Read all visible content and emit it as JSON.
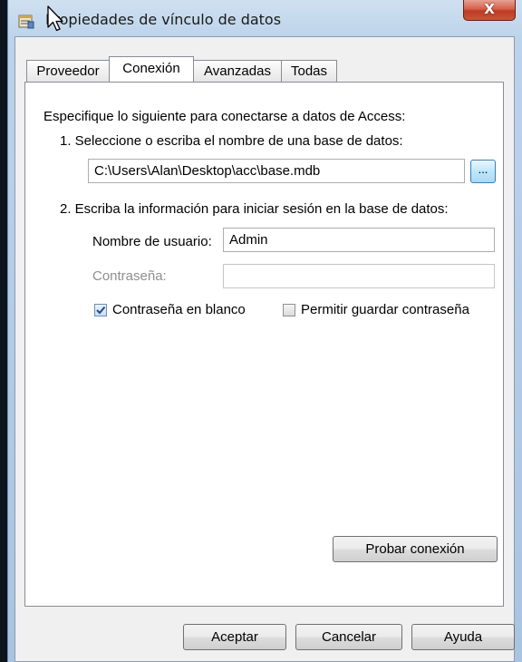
{
  "window": {
    "title": "Propiedades de vínculo de datos",
    "close_label": "X"
  },
  "tabs": [
    {
      "label": "Proveedor",
      "active": false
    },
    {
      "label": "Conexión",
      "active": true
    },
    {
      "label": "Avanzadas",
      "active": false
    },
    {
      "label": "Todas",
      "active": false
    }
  ],
  "connection": {
    "intro": "Especifique lo siguiente para conectarse a datos de Access:",
    "step1_label": "1. Seleccione o escriba el nombre de una base de datos:",
    "database_path": "C:\\Users\\Alan\\Desktop\\acc\\base.mdb",
    "browse_label": "...",
    "step2_label": "2. Escriba la información para iniciar sesión en la base de datos:",
    "username_label": "Nombre de usuario:",
    "username_value": "Admin",
    "password_label": "Contraseña:",
    "password_value": "",
    "blank_password_label": "Contraseña en blanco",
    "blank_password_checked": true,
    "save_password_label": "Permitir guardar contraseña",
    "save_password_checked": false,
    "test_button": "Probar conexión"
  },
  "footer": {
    "ok": "Aceptar",
    "cancel": "Cancelar",
    "help": "Ayuda"
  }
}
